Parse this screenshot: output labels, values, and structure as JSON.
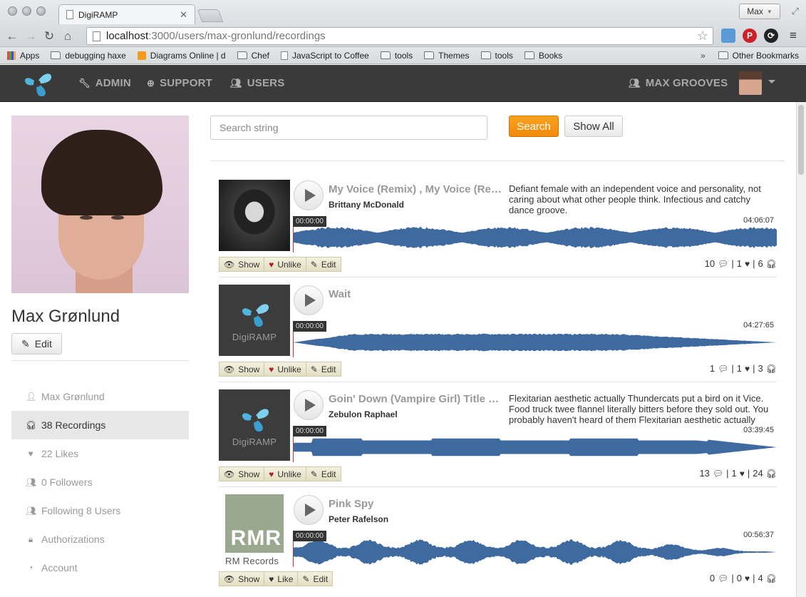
{
  "browser": {
    "tab_title": "DigiRAMP",
    "profile": "Max",
    "url_host": "localhost",
    "url_path": ":3000/users/max-gronlund/recordings",
    "bookmarks": [
      "Apps",
      "debugging haxe",
      "Diagrams Online | d",
      "Chef",
      "JavaScript to Coffee",
      "tools",
      "Themes",
      "tools",
      "Books"
    ],
    "other_bookmarks": "Other Bookmarks"
  },
  "navbar": {
    "admin": "ADMIN",
    "support": "SUPPORT",
    "users": "USERS",
    "account": "MAX GROOVES"
  },
  "sidebar": {
    "name": "Max Grønlund",
    "edit": "Edit",
    "items": [
      {
        "label": "Max Grønlund"
      },
      {
        "label": "38 Recordings"
      },
      {
        "label": "22  Likes"
      },
      {
        "label": "0 Followers"
      },
      {
        "label": "Following 8 Users"
      },
      {
        "label": "Authorizations"
      },
      {
        "label": "Account"
      }
    ]
  },
  "search": {
    "placeholder": "Search string",
    "search_label": "Search",
    "show_all_label": "Show All"
  },
  "recordings": [
    {
      "title": "My Voice (Remix) , My Voice (Remix)",
      "artist": "Brittany McDonald",
      "description": "Defiant female with an independent voice and personality, not caring about what other people think. Infectious and catchy dance groove.",
      "position": "00:00:00",
      "duration": "04:06:07",
      "show": "Show",
      "like": "Unlike",
      "edit": "Edit",
      "comments": "10",
      "likes": "1",
      "plays": "6"
    },
    {
      "title": "Wait",
      "artist": "",
      "description": "",
      "cover_brand": "DigiRAMP",
      "position": "00:00:00",
      "duration": "04:27:65",
      "show": "Show",
      "like": "Unlike",
      "edit": "Edit",
      "comments": "1",
      "likes": "1",
      "plays": "3"
    },
    {
      "title": "Goin' Down (Vampire Girl) Title Track",
      "artist": "Zebulon Raphael",
      "description": "Flexitarian aesthetic actually Thundercats put a bird on it Vice. Food truck twee flannel literally bitters before they sold out. You probably haven't heard of them Flexitarian aesthetic actually",
      "cover_brand": "DigiRAMP",
      "position": "00:00:00",
      "duration": "03:39:45",
      "show": "Show",
      "like": "Unlike",
      "edit": "Edit",
      "comments": "13",
      "likes": "1",
      "plays": "24"
    },
    {
      "title": "Pink Spy",
      "artist": "Peter Rafelson",
      "description": "",
      "cover_big": "RMR",
      "cover_label": "RM Records",
      "position": "00:00:00",
      "duration": "00:56:37",
      "show": "Show",
      "like": "Like",
      "edit": "Edit",
      "comments": "0",
      "likes": "0",
      "plays": "4"
    }
  ],
  "colors": {
    "nav_bg": "#3a3a3a",
    "wave": "#3f6aa0",
    "search_orange": "#f7941d",
    "logo_blue": "#4fb5dc"
  }
}
